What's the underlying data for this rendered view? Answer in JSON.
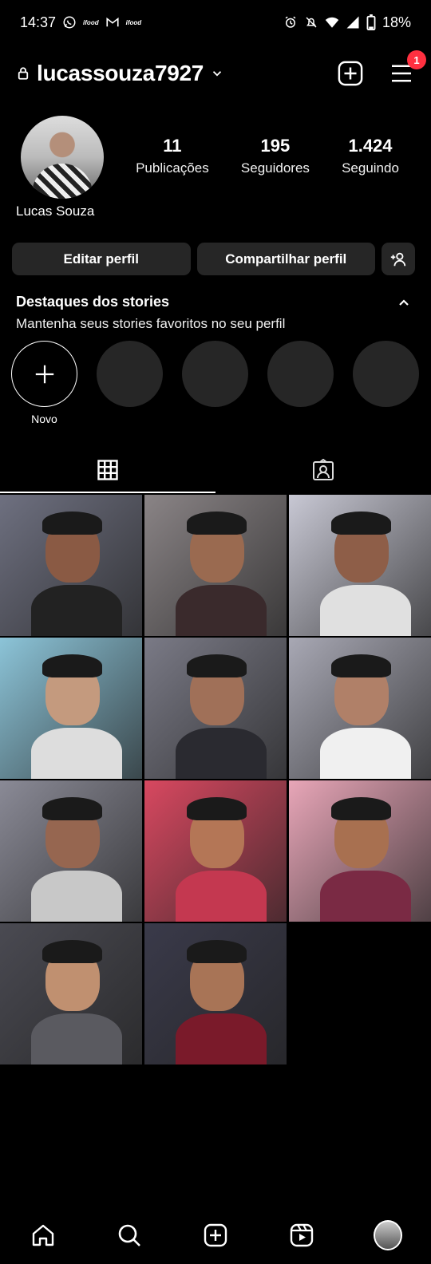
{
  "status_bar": {
    "time": "14:37",
    "app_logo_1": "ifood",
    "app_logo_2": "ifood",
    "battery": "18%"
  },
  "header": {
    "username": "lucassouza7927",
    "menu_badge": "1"
  },
  "profile": {
    "full_name": "Lucas Souza",
    "stats": [
      {
        "value": "11",
        "label": "Publicações"
      },
      {
        "value": "195",
        "label": "Seguidores"
      },
      {
        "value": "1.424",
        "label": "Seguindo"
      }
    ]
  },
  "actions": {
    "edit_label": "Editar perfil",
    "share_label": "Compartilhar perfil"
  },
  "highlights": {
    "title": "Destaques dos stories",
    "subtitle": "Mantenha seus stories favoritos no seu perfil",
    "new_label": "Novo"
  },
  "posts": [
    {
      "bg": "#6e7080",
      "skin": "#8a5a44",
      "shirt": "#222222"
    },
    {
      "bg": "#8a8486",
      "skin": "#9a6a50",
      "shirt": "#3a2a2c"
    },
    {
      "bg": "#c8c8d4",
      "skin": "#8e5e48",
      "shirt": "#e0e0e0"
    },
    {
      "bg": "#8cc4d8",
      "skin": "#c49a7e",
      "shirt": "#dddddd"
    },
    {
      "bg": "#7a7a86",
      "skin": "#a07058",
      "shirt": "#2a2a30"
    },
    {
      "bg": "#a8a8b4",
      "skin": "#b08068",
      "shirt": "#f0f0f0"
    },
    {
      "bg": "#8a8a96",
      "skin": "#966650",
      "shirt": "#c8c8c8"
    },
    {
      "bg": "#d84860",
      "skin": "#b47656",
      "shirt": "#c43850"
    },
    {
      "bg": "#e8a6b8",
      "skin": "#a87050",
      "shirt": "#7a2a44"
    },
    {
      "bg": "#4a4a52",
      "skin": "#c09070",
      "shirt": "#5a5a60"
    },
    {
      "bg": "#3a3a4a",
      "skin": "#a87456",
      "shirt": "#7a1a2a"
    }
  ]
}
